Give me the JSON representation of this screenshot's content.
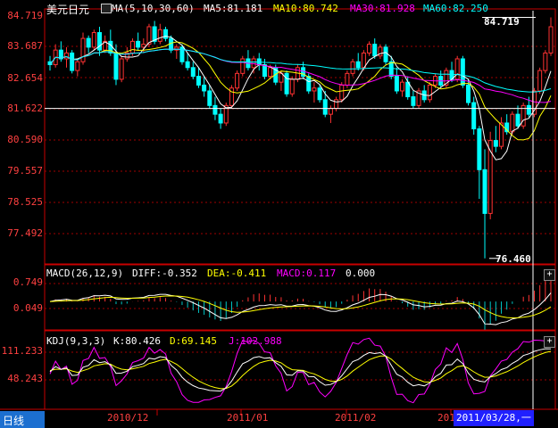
{
  "colors": {
    "up": "#ff3232",
    "down": "#00ffff",
    "ma5": "#ffffff",
    "ma10": "#ffff00",
    "ma30": "#ff00ff",
    "ma60": "#00ffff",
    "frame": "#c80000",
    "axis": "#ff4040"
  },
  "main_panel": {
    "title": "美元日元",
    "ma_params": "MA(5,10,30,60)",
    "ma5": "MA5:81.181",
    "ma10": "MA10:80.742",
    "ma30": "MA30:81.928",
    "ma60": "MA60:82.250",
    "y_labels": [
      "84.719",
      "83.687",
      "82.654",
      "81.622",
      "80.590",
      "79.557",
      "78.525",
      "77.492"
    ],
    "high_label": "84.719",
    "low_label": "76.460"
  },
  "macd_panel": {
    "params": "MACD(26,12,9)",
    "diff": "DIFF:-0.352",
    "dea": "DEA:-0.411",
    "macd": "MACD:0.117",
    "extra": "0.000",
    "y_labels": [
      "0.749",
      "0.049"
    ]
  },
  "kdj_panel": {
    "params": "KDJ(9,3,3)",
    "k": "K:80.426",
    "d": "D:69.145",
    "j": "J:102.988",
    "y_labels": [
      "111.233",
      "48.243"
    ]
  },
  "bottom": {
    "period_label": "日线",
    "x_labels": [
      "2010/12",
      "2011/01",
      "2011/02",
      "201"
    ],
    "cursor_date": "2011/03/28,一"
  },
  "chart_data": {
    "type": "candlestick",
    "ylim": [
      76.3,
      84.95
    ],
    "macd_ylim": [
      -0.8,
      1.05
    ],
    "kdj_ylim": [
      -25,
      125
    ],
    "candles": [
      [
        83.2,
        83.4,
        82.9,
        83.1
      ],
      [
        83.1,
        83.8,
        83.0,
        83.6
      ],
      [
        83.6,
        83.9,
        83.2,
        83.3
      ],
      [
        83.3,
        83.7,
        83.0,
        83.5
      ],
      [
        83.5,
        83.6,
        82.8,
        82.9
      ],
      [
        82.9,
        83.3,
        82.7,
        83.2
      ],
      [
        83.2,
        84.2,
        83.1,
        84.0
      ],
      [
        84.0,
        84.1,
        83.5,
        83.7
      ],
      [
        83.7,
        84.3,
        83.6,
        84.2
      ],
      [
        84.2,
        84.4,
        83.4,
        83.6
      ],
      [
        83.6,
        84.1,
        83.5,
        83.9
      ],
      [
        83.9,
        84.3,
        83.4,
        83.5
      ],
      [
        83.5,
        83.8,
        82.4,
        82.6
      ],
      [
        82.6,
        83.4,
        82.5,
        83.3
      ],
      [
        83.3,
        83.7,
        83.2,
        83.5
      ],
      [
        83.5,
        84.0,
        83.4,
        83.9
      ],
      [
        83.9,
        84.2,
        83.6,
        83.7
      ],
      [
        83.7,
        84.0,
        83.5,
        83.8
      ],
      [
        83.8,
        84.5,
        83.7,
        84.4
      ],
      [
        84.4,
        84.6,
        83.8,
        83.9
      ],
      [
        83.9,
        84.5,
        83.8,
        84.3
      ],
      [
        84.3,
        84.4,
        83.9,
        84.0
      ],
      [
        84.0,
        84.1,
        83.5,
        83.6
      ],
      [
        83.6,
        83.8,
        83.3,
        83.7
      ],
      [
        83.7,
        83.8,
        83.1,
        83.2
      ],
      [
        83.2,
        83.5,
        82.9,
        83.0
      ],
      [
        83.0,
        83.2,
        82.6,
        82.7
      ],
      [
        82.7,
        83.0,
        82.3,
        82.4
      ],
      [
        82.4,
        82.7,
        82.0,
        82.2
      ],
      [
        82.2,
        82.4,
        81.6,
        81.7
      ],
      [
        81.7,
        82.0,
        81.2,
        81.4
      ],
      [
        81.4,
        81.6,
        80.9,
        81.1
      ],
      [
        81.1,
        81.8,
        81.0,
        81.7
      ],
      [
        81.7,
        82.4,
        81.6,
        82.3
      ],
      [
        82.3,
        82.9,
        82.2,
        82.8
      ],
      [
        82.8,
        83.4,
        82.7,
        83.3
      ],
      [
        83.3,
        83.6,
        82.9,
        83.0
      ],
      [
        83.0,
        83.4,
        82.8,
        83.3
      ],
      [
        83.3,
        83.5,
        82.9,
        83.1
      ],
      [
        83.1,
        83.3,
        82.6,
        82.7
      ],
      [
        82.7,
        83.1,
        82.6,
        83.0
      ],
      [
        83.0,
        83.1,
        82.4,
        82.5
      ],
      [
        82.5,
        82.9,
        82.2,
        82.8
      ],
      [
        82.8,
        82.9,
        82.0,
        82.1
      ],
      [
        82.1,
        82.7,
        82.0,
        82.6
      ],
      [
        82.6,
        83.1,
        82.5,
        83.0
      ],
      [
        83.0,
        83.2,
        82.6,
        82.7
      ],
      [
        82.7,
        82.8,
        82.1,
        82.2
      ],
      [
        82.2,
        82.5,
        81.8,
        82.3
      ],
      [
        82.3,
        82.4,
        81.8,
        81.9
      ],
      [
        81.9,
        82.2,
        81.3,
        81.4
      ],
      [
        81.4,
        81.7,
        81.1,
        81.6
      ],
      [
        81.6,
        82.0,
        81.5,
        81.9
      ],
      [
        81.9,
        82.5,
        81.8,
        82.4
      ],
      [
        82.4,
        82.9,
        82.3,
        82.8
      ],
      [
        82.8,
        83.3,
        82.7,
        83.2
      ],
      [
        83.2,
        83.5,
        82.9,
        83.0
      ],
      [
        83.0,
        83.6,
        82.9,
        83.5
      ],
      [
        83.5,
        83.9,
        83.4,
        83.8
      ],
      [
        83.8,
        84.0,
        83.3,
        83.4
      ],
      [
        83.4,
        83.8,
        83.3,
        83.7
      ],
      [
        83.7,
        83.8,
        83.1,
        83.2
      ],
      [
        83.2,
        83.4,
        82.6,
        82.7
      ],
      [
        82.7,
        83.0,
        82.1,
        82.2
      ],
      [
        82.2,
        82.6,
        82.0,
        82.5
      ],
      [
        82.5,
        82.7,
        81.9,
        82.0
      ],
      [
        82.0,
        82.2,
        81.6,
        81.7
      ],
      [
        81.7,
        82.3,
        81.6,
        82.2
      ],
      [
        82.2,
        82.4,
        81.8,
        81.9
      ],
      [
        81.9,
        82.5,
        81.8,
        82.4
      ],
      [
        82.4,
        82.8,
        82.3,
        82.7
      ],
      [
        82.7,
        82.9,
        82.3,
        82.4
      ],
      [
        82.4,
        83.0,
        82.3,
        82.9
      ],
      [
        82.9,
        83.2,
        82.5,
        82.6
      ],
      [
        82.6,
        83.4,
        82.5,
        83.3
      ],
      [
        83.3,
        83.4,
        82.3,
        82.4
      ],
      [
        82.4,
        82.6,
        81.7,
        81.8
      ],
      [
        81.8,
        82.0,
        80.7,
        80.9
      ],
      [
        80.9,
        81.0,
        78.5,
        79.5
      ],
      [
        79.5,
        80.2,
        76.46,
        78.0
      ],
      [
        78.0,
        80.8,
        77.8,
        80.5
      ],
      [
        80.5,
        81.0,
        80.1,
        80.3
      ],
      [
        80.3,
        81.3,
        80.2,
        81.1
      ],
      [
        81.1,
        81.4,
        80.7,
        80.8
      ],
      [
        80.8,
        81.5,
        80.7,
        81.4
      ],
      [
        81.4,
        81.7,
        80.9,
        81.0
      ],
      [
        81.0,
        81.8,
        80.9,
        81.7
      ],
      [
        81.7,
        82.0,
        81.3,
        81.4
      ],
      [
        81.4,
        82.3,
        81.3,
        82.2
      ],
      [
        82.2,
        83.0,
        82.1,
        82.9
      ],
      [
        82.9,
        83.6,
        82.8,
        83.5
      ],
      [
        83.5,
        84.719,
        83.4,
        84.4
      ]
    ]
  }
}
